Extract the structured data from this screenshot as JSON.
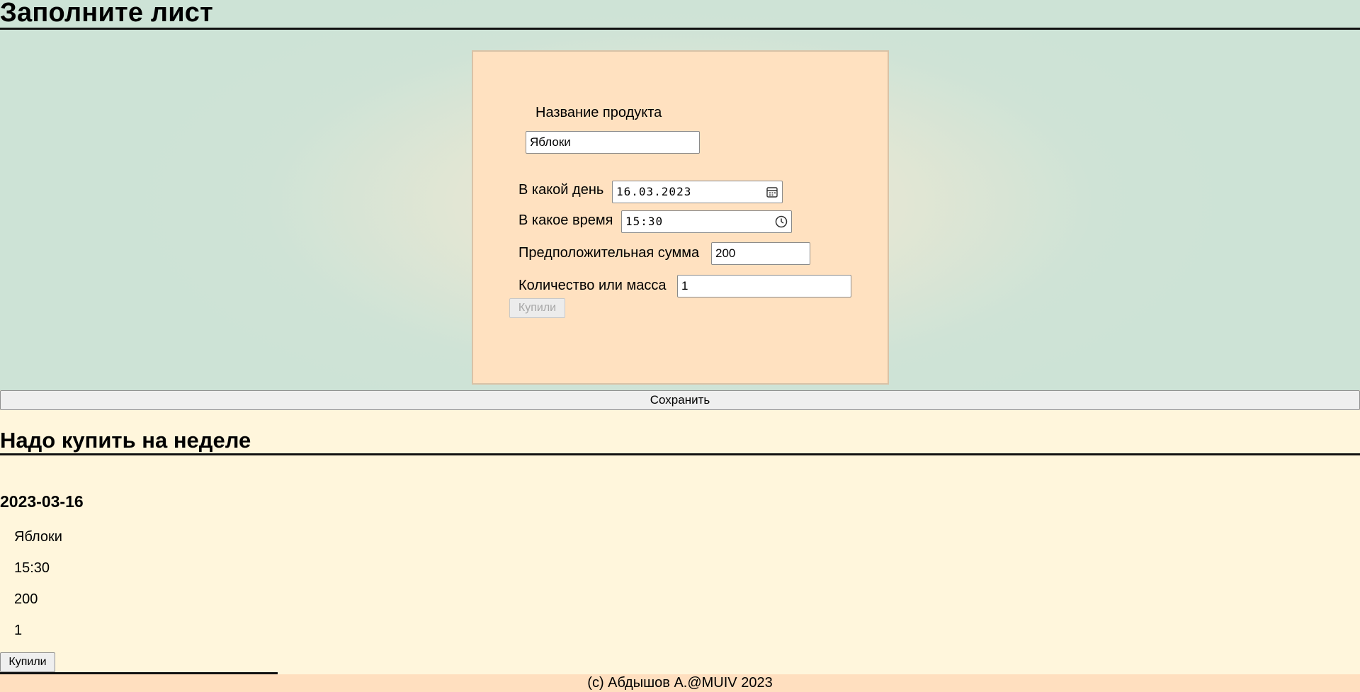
{
  "header": {
    "title": "Заполните лист"
  },
  "form": {
    "product_label": "Название продукта",
    "product_value": "Яблоки",
    "day_label": "В какой день",
    "day_value": "16.03.2023",
    "time_label": "В какое время",
    "time_value": "15:30",
    "sum_label": "Предположительная сумма",
    "sum_value": "200",
    "qty_label": "Количество или масса",
    "qty_value": "1",
    "bought_button": "Купили",
    "calendar_icon": "calendar-icon",
    "clock_icon": "clock-icon"
  },
  "save_button": "Сохранить",
  "week": {
    "title": "Надо купить на неделе",
    "date": "2023-03-16",
    "item": {
      "product": "Яблоки",
      "time": "15:30",
      "sum": "200",
      "qty": "1"
    },
    "bought_button": "Купили"
  },
  "footer": {
    "text": "(c) Абдышов А.@MUIV 2023"
  },
  "colors": {
    "top_bg": "#cde3d6",
    "card_bg": "#ffe1c0",
    "list_bg": "#fff6dc",
    "footer_bg": "#ffdfbf"
  }
}
